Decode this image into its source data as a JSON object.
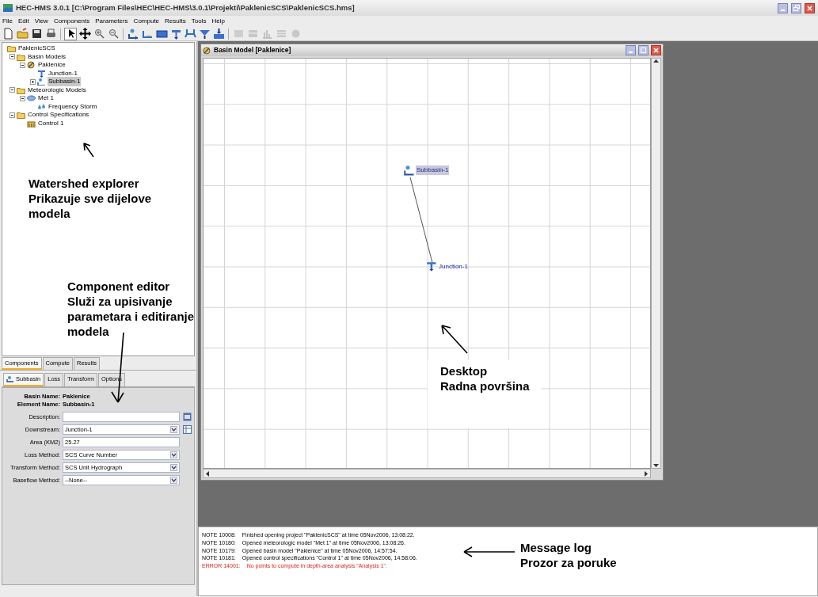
{
  "window": {
    "title": "HEC-HMS 3.0.1 [C:\\Program Files\\HEC\\HEC-HMS\\3.0.1\\Projekti\\PaklenicSCS\\PaklenicSCS.hms]"
  },
  "menu": [
    "File",
    "Edit",
    "View",
    "Components",
    "Parameters",
    "Compute",
    "Results",
    "Tools",
    "Help"
  ],
  "toolbar": [
    {
      "selected": false,
      "disabled": false
    },
    {
      "selected": false,
      "disabled": false
    },
    {
      "selected": false,
      "disabled": false
    },
    {
      "selected": false,
      "disabled": false
    },
    {
      "selected": true,
      "disabled": false
    },
    {
      "selected": false,
      "disabled": false
    },
    {
      "selected": false,
      "disabled": false
    },
    {
      "selected": false,
      "disabled": false
    },
    {
      "selected": false,
      "disabled": false
    },
    {
      "selected": false,
      "disabled": false
    },
    {
      "selected": false,
      "disabled": false
    },
    {
      "selected": false,
      "disabled": false
    },
    {
      "selected": false,
      "disabled": false
    },
    {
      "selected": false,
      "disabled": false
    },
    {
      "selected": false,
      "disabled": false
    },
    {
      "selected": false,
      "disabled": true
    },
    {
      "selected": false,
      "disabled": true
    },
    {
      "selected": false,
      "disabled": true
    },
    {
      "selected": false,
      "disabled": true
    },
    {
      "selected": false,
      "disabled": true
    }
  ],
  "explorer": {
    "tree": [
      {
        "label": "PaklenicSCS",
        "kind": "folder",
        "selected": false,
        "children": [
          {
            "label": "Basin Models",
            "kind": "folder",
            "selected": false,
            "expanded": true,
            "children": [
              {
                "label": "Paklenice",
                "kind": "basin",
                "selected": false,
                "expanded": true,
                "children": [
                  {
                    "label": "Junction-1",
                    "kind": "junction",
                    "selected": false
                  },
                  {
                    "label": "Subbasin-1",
                    "kind": "subbasin",
                    "selected": true,
                    "expanded": false
                  }
                ]
              }
            ]
          },
          {
            "label": "Meteorologic Models",
            "kind": "folder",
            "selected": false,
            "expanded": true,
            "children": [
              {
                "label": "Met 1",
                "kind": "met",
                "selected": false,
                "expanded": true,
                "children": [
                  {
                    "label": "Frequency Storm",
                    "kind": "storm",
                    "selected": false
                  }
                ]
              }
            ]
          },
          {
            "label": "Control Specifications",
            "kind": "folder",
            "selected": false,
            "expanded": true,
            "children": [
              {
                "label": "Control 1",
                "kind": "control",
                "selected": false
              }
            ]
          }
        ]
      }
    ],
    "tabs": [
      {
        "label": "Components",
        "selected": true
      },
      {
        "label": "Compute",
        "selected": false
      },
      {
        "label": "Results",
        "selected": false
      }
    ]
  },
  "component_editor": {
    "tabs": [
      {
        "label": "Subbasin",
        "selected": true
      },
      {
        "label": "Loss",
        "selected": false
      },
      {
        "label": "Transform",
        "selected": false
      },
      {
        "label": "Options",
        "selected": false
      }
    ],
    "info": [
      {
        "label": "Basin Name:",
        "value": "Paklenice"
      },
      {
        "label": "Element Name:",
        "value": "Subbasin-1"
      }
    ],
    "fields": [
      {
        "label": "Description:",
        "kind": "text",
        "has_button": true
      },
      {
        "label": "Downstream:",
        "kind": "select",
        "value": "Junction-1",
        "has_button": true
      },
      {
        "label": "Area (KM2)",
        "kind": "text",
        "value": "25.27",
        "has_button": false
      },
      {
        "label": "Loss Method:",
        "kind": "select",
        "value": "SCS Curve Number",
        "has_button": false
      },
      {
        "label": "Transform Method:",
        "kind": "select",
        "value": "SCS Unit Hydrograph",
        "has_button": false
      },
      {
        "label": "Baseflow Method:",
        "kind": "select",
        "value": "--None--",
        "has_button": false
      }
    ]
  },
  "basin_window": {
    "title": "Basin Model [Paklenice]",
    "elements": [
      {
        "kind": "subbasin",
        "label": "Subbasin-1",
        "selected": true
      },
      {
        "kind": "junction",
        "label": "Junction-1",
        "selected": false
      }
    ]
  },
  "message_log": [
    {
      "kind": "note",
      "code": "NOTE 10008:",
      "message": "Finished opening project \"PaklenicSCS\" at time 05Nov2006, 13:08:22."
    },
    {
      "kind": "note",
      "code": "NOTE 10180:",
      "message": "Opened meteorologic model \"Met 1\" at time 05Nov2006, 13:08:26."
    },
    {
      "kind": "note",
      "code": "NOTE 10179:",
      "message": "Opened basin model \"Paklenice\" at time 05Nov2006, 14:57:54."
    },
    {
      "kind": "note",
      "code": "NOTE 10181:",
      "message": "Opened control specifications \"Control 1\" at time 05Nov2006, 14:58:06."
    },
    {
      "kind": "error",
      "code": "ERROR 14001:",
      "message": "No points to compute in depth-area analysis \"Analysis 1\"."
    }
  ],
  "annotations": [
    {
      "text": "Watershed explorer\nPrikazuje sve dijelove\nmodela"
    },
    {
      "text": "Component editor\nSluži za upisivanje\nparametara i editiranje\nmodela"
    },
    {
      "text": "Desktop\nRadna površina"
    },
    {
      "text": "Message log\nProzor za poruke"
    }
  ]
}
